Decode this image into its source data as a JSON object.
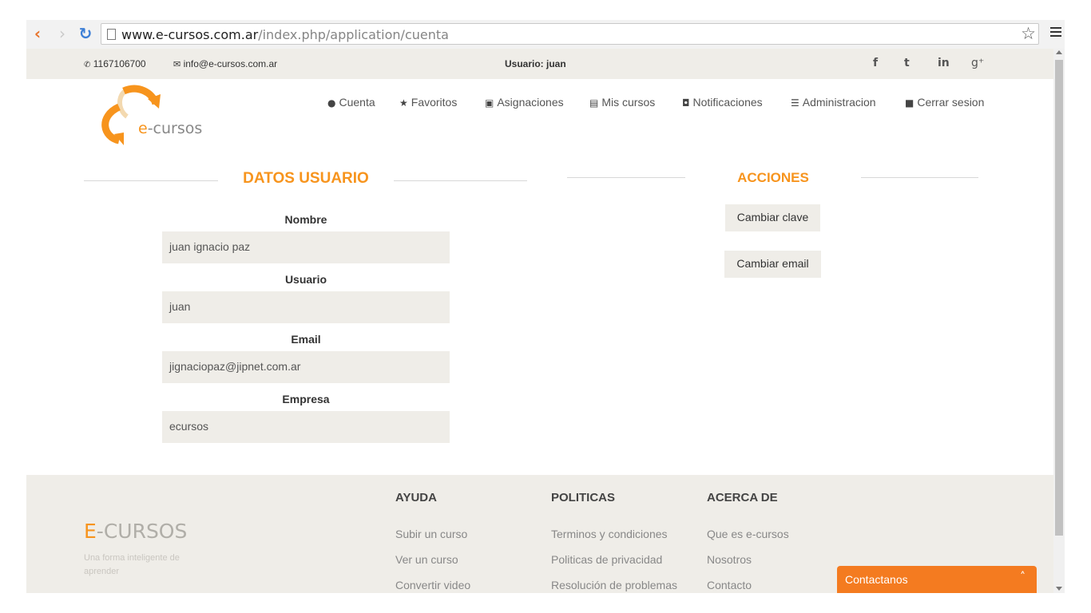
{
  "browser": {
    "url_domain": "www.e-cursos.com.ar",
    "url_path": "/index.php/application/cuenta"
  },
  "topbar": {
    "phone": "1167106700",
    "email": "info@e-cursos.com.ar",
    "usuario": "Usuario: juan",
    "social": [
      "facebook-icon",
      "twitter-icon",
      "linkedin-icon",
      "google-plus-icon"
    ]
  },
  "logo": {
    "text_e": "e",
    "text_rest": "-cursos"
  },
  "nav": {
    "items": [
      {
        "label": "Cuenta",
        "icon": "user-icon"
      },
      {
        "label": "Favoritos",
        "icon": "star-icon"
      },
      {
        "label": "Asignaciones",
        "icon": "assign-icon"
      },
      {
        "label": "Mis cursos",
        "icon": "document-icon"
      },
      {
        "label": "Notificaciones",
        "icon": "inbox-icon"
      },
      {
        "label": "Administracion",
        "icon": "list-icon"
      },
      {
        "label": "Cerrar sesion",
        "icon": "lock-icon"
      }
    ]
  },
  "datos": {
    "title": "DATOS USUARIO",
    "fields": [
      {
        "label": "Nombre",
        "value": "juan ignacio paz"
      },
      {
        "label": "Usuario",
        "value": "juan"
      },
      {
        "label": "Email",
        "value": "jignaciopaz@jipnet.com.ar"
      },
      {
        "label": "Empresa",
        "value": "ecursos"
      }
    ]
  },
  "acciones": {
    "title": "ACCIONES",
    "buttons": [
      "Cambiar clave",
      "Cambiar email"
    ]
  },
  "footer": {
    "brand_e": "E",
    "brand_rest": "-CURSOS",
    "tagline": "Una forma inteligente de aprender",
    "columns": [
      {
        "heading": "AYUDA",
        "links": [
          "Subir un curso",
          "Ver un curso",
          "Convertir video"
        ]
      },
      {
        "heading": "POLITICAS",
        "links": [
          "Terminos y condiciones",
          "Politicas de privacidad",
          "Resolución de problemas"
        ]
      },
      {
        "heading": "ACERCA DE",
        "links": [
          "Que es e-cursos",
          "Nosotros",
          "Contacto"
        ]
      }
    ]
  },
  "contact_widget": {
    "label": "Contactanos"
  },
  "colors": {
    "accent": "#f7941d",
    "contact_bar": "#f47b20",
    "panel_bg": "#efede8"
  }
}
